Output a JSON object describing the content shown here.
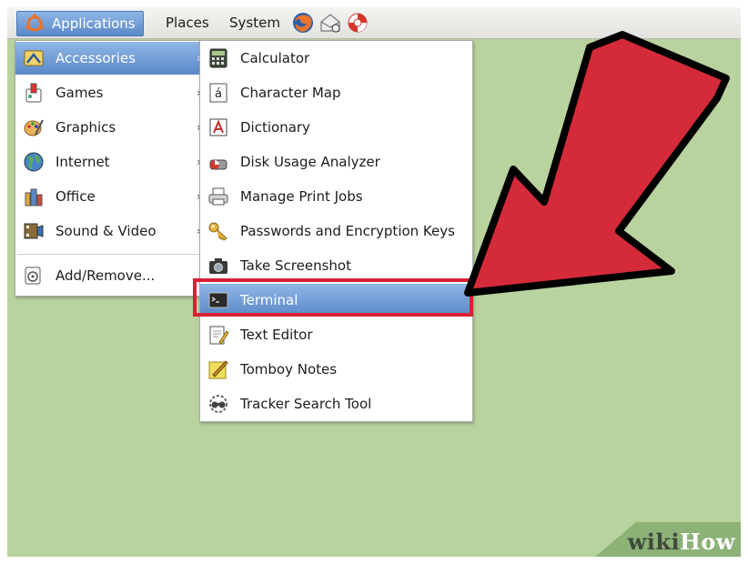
{
  "panel": {
    "applications_label": "Applications",
    "places_label": "Places",
    "system_label": "System",
    "icons": [
      "firefox-icon",
      "mail-icon",
      "help-lifebuoy-icon"
    ]
  },
  "applications_menu": {
    "items": [
      {
        "label": "Accessories",
        "icon": "accessories-icon",
        "submenu": true,
        "selected": true
      },
      {
        "label": "Games",
        "icon": "games-icon",
        "submenu": true
      },
      {
        "label": "Graphics",
        "icon": "graphics-icon",
        "submenu": true
      },
      {
        "label": "Internet",
        "icon": "globe-icon",
        "submenu": true
      },
      {
        "label": "Office",
        "icon": "office-icon",
        "submenu": true
      },
      {
        "label": "Sound & Video",
        "icon": "sound-video-icon",
        "submenu": true
      },
      {
        "label": "Add/Remove...",
        "icon": "add-remove-icon",
        "submenu": false
      }
    ],
    "arrow_glyph": "›"
  },
  "accessories_menu": {
    "items": [
      {
        "label": "Calculator",
        "icon": "calculator-icon"
      },
      {
        "label": "Character Map",
        "icon": "character-map-icon",
        "glyph": "á"
      },
      {
        "label": "Dictionary",
        "icon": "dictionary-icon"
      },
      {
        "label": "Disk Usage Analyzer",
        "icon": "disk-usage-icon"
      },
      {
        "label": "Manage Print Jobs",
        "icon": "printer-icon"
      },
      {
        "label": "Passwords and Encryption Keys",
        "icon": "keys-icon"
      },
      {
        "label": "Take Screenshot",
        "icon": "camera-icon"
      },
      {
        "label": "Terminal",
        "icon": "terminal-icon",
        "selected": true
      },
      {
        "label": "Text Editor",
        "icon": "text-editor-icon"
      },
      {
        "label": "Tomboy Notes",
        "icon": "tomboy-notes-icon"
      },
      {
        "label": "Tracker Search Tool",
        "icon": "tracker-search-icon"
      }
    ]
  },
  "watermark": {
    "part1": "wiki",
    "part2": "How"
  },
  "colors": {
    "desktop": "#b9d39f",
    "selection": "#5a89c8",
    "callout_red": "#d92035"
  }
}
